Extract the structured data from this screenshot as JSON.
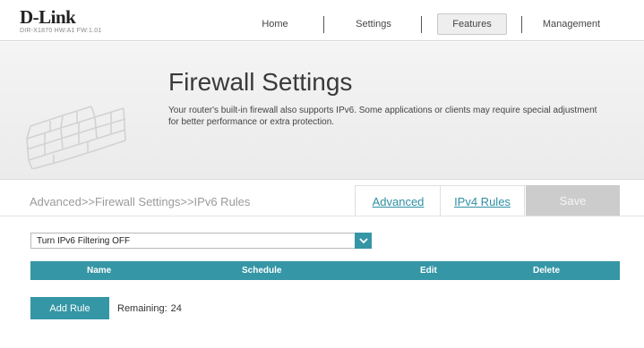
{
  "brand": {
    "logo": "D-Link",
    "model": "DIR-X1870 HW:A1 FW:1.01"
  },
  "nav": {
    "home": "Home",
    "settings": "Settings",
    "features": "Features",
    "management": "Management"
  },
  "banner": {
    "title": "Firewall Settings",
    "description": "Your router's built-in firewall also supports IPv6. Some applications or clients may require special adjustment for better performance or extra protection."
  },
  "toolbar": {
    "breadcrumb": "Advanced>>Firewall Settings>>IPv6 Rules",
    "advanced_link": "Advanced",
    "ipv4_link": "IPv4 Rules",
    "save_label": "Save"
  },
  "filter": {
    "selected": "Turn IPv6 Filtering OFF"
  },
  "table": {
    "columns": [
      "Name",
      "Schedule",
      "Edit",
      "Delete"
    ],
    "rows": []
  },
  "rules": {
    "add_label": "Add Rule",
    "remaining_label": "Remaining:",
    "remaining_count": "24"
  },
  "colors": {
    "accent": "#3596a6",
    "disabled": "#cccccc",
    "link": "#2f8fa3"
  },
  "icons": {
    "select_arrow": "chevron-down-icon",
    "banner_art": "brick-wall-icon"
  }
}
